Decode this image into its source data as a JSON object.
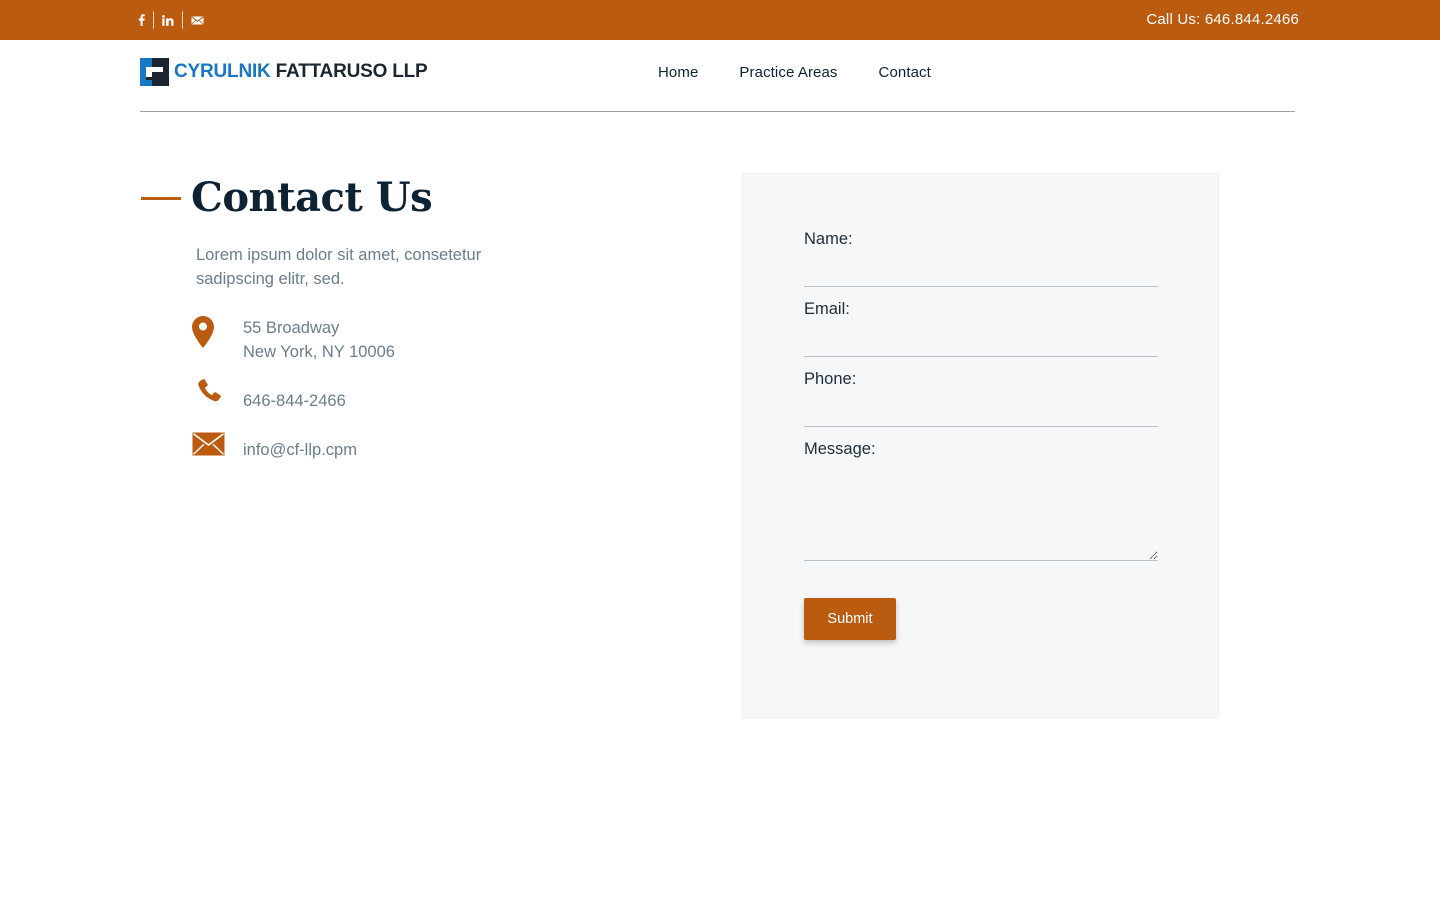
{
  "topbar": {
    "social": [
      {
        "name": "facebook-icon",
        "glyph": "f"
      },
      {
        "name": "linkedin-icon",
        "glyph": "in"
      },
      {
        "name": "email-icon",
        "glyph": ""
      }
    ],
    "call_us": "Call Us: 646.844.2466"
  },
  "header": {
    "logo_part1": "CYRULNIK",
    "logo_part2": "FATTARUSO LLP",
    "nav": [
      "Home",
      "Practice Areas",
      "Contact"
    ]
  },
  "contact": {
    "title": "Contact Us",
    "intro": "Lorem ipsum dolor sit amet, consetetur sadipscing elitr, sed.",
    "address_line1": "55 Broadway",
    "address_line2": "New York, NY 10006",
    "phone": "646-844-2466",
    "email": "info@cf-llp.cpm"
  },
  "form": {
    "name_label": "Name:",
    "email_label": "Email:",
    "phone_label": "Phone:",
    "message_label": "Message:",
    "name_value": "",
    "email_value": "",
    "phone_value": "",
    "message_value": "",
    "submit_label": "Submit"
  },
  "colors": {
    "accent": "#bb5b10",
    "heading": "#0d2233",
    "muted_text": "#6a7d8c",
    "logo_blue": "#1777c4"
  }
}
